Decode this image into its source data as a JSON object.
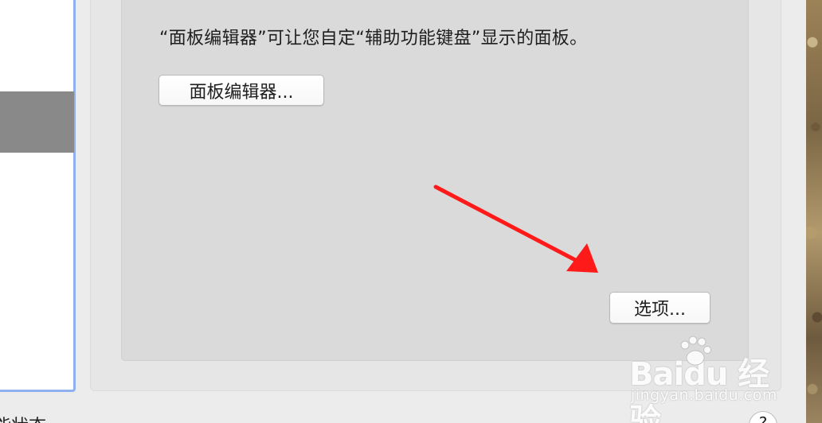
{
  "panel": {
    "description": "“面板编辑器”可让您自定“辅助功能键盘”显示的面板。",
    "panel_editor_button": "面板编辑器...",
    "options_button": "选项..."
  },
  "footer": {
    "status_text": "能状态",
    "help_button": "?"
  },
  "watermark": {
    "logo_text": "Baidu 经验",
    "url": "jingyan.baidu.com"
  },
  "colors": {
    "arrow": "#ff1a1a",
    "sidebar_border": "#8fb0ef",
    "sidebar_selection": "#898989"
  }
}
